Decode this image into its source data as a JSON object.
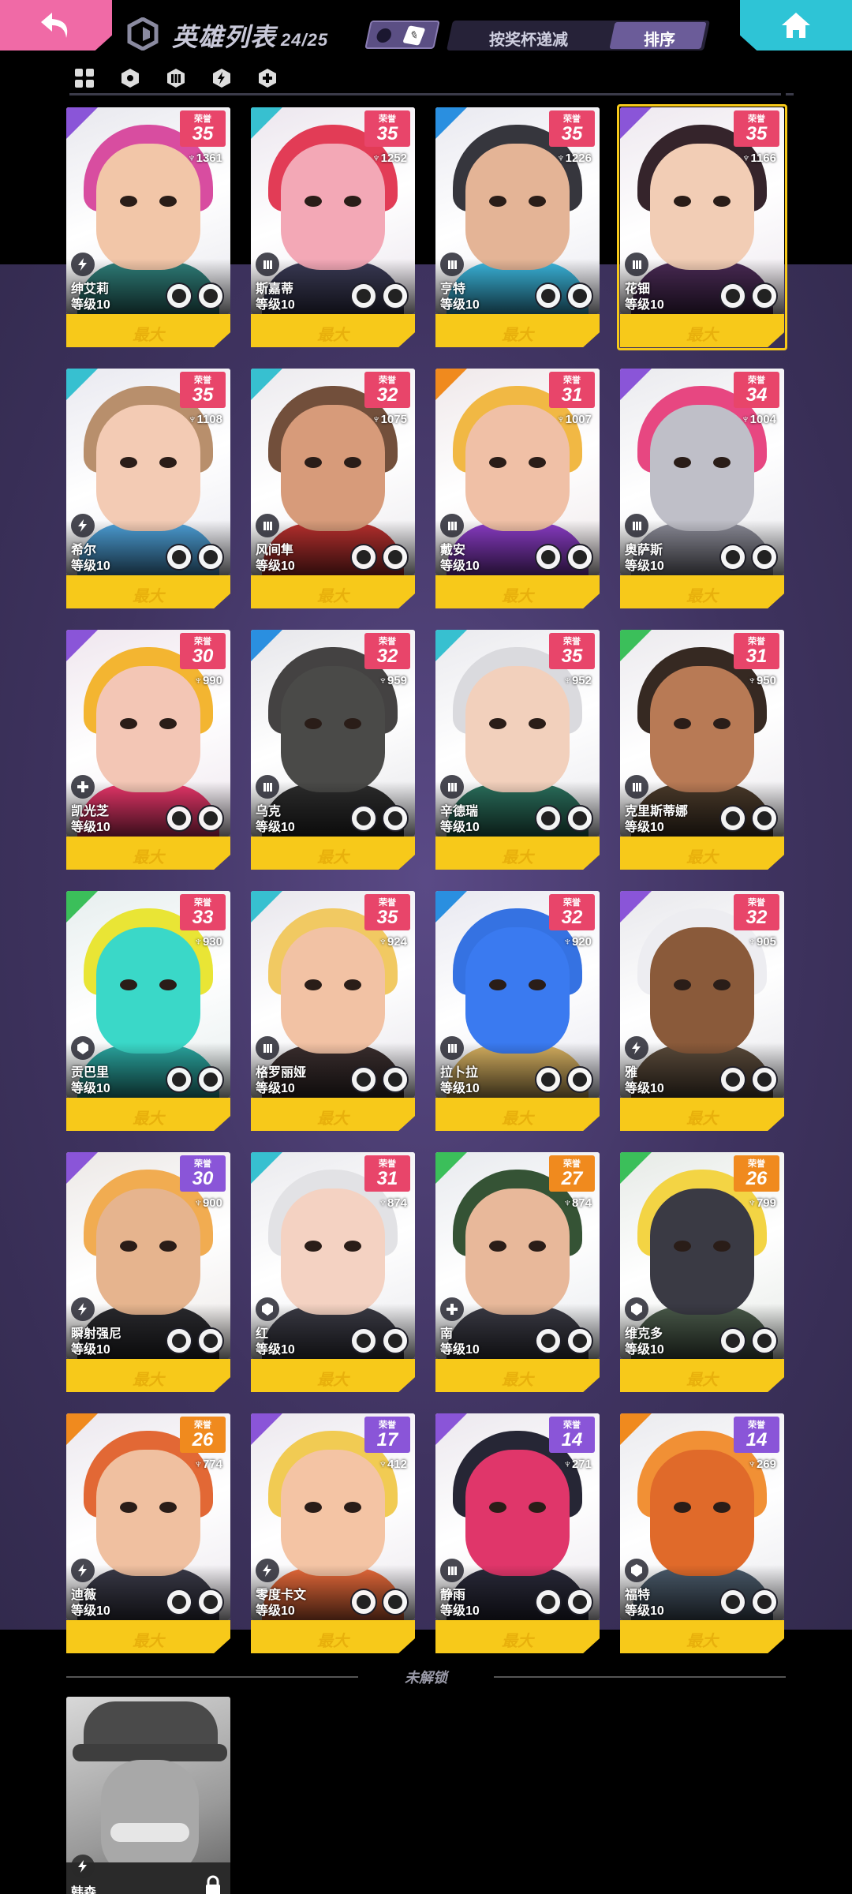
{
  "header": {
    "title": "英雄列表",
    "count": "24/25",
    "filter_label": "按奖杯递减",
    "sort_label": "排序",
    "back_icon": "back-arrow-icon",
    "home_icon": "home-icon",
    "accent_back": "#f06aa6",
    "accent_home": "#2ec4d6"
  },
  "class_tabs": [
    {
      "icon": "grid-all-icon"
    },
    {
      "icon": "shield-icon"
    },
    {
      "icon": "tank-icon"
    },
    {
      "icon": "bolt-icon"
    },
    {
      "icon": "plus-icon"
    }
  ],
  "common": {
    "rank_label": "荣誉",
    "max_label": "最大"
  },
  "heroes": [
    {
      "name": "绅艾莉",
      "level": "等级10",
      "rank": "35",
      "trophies": "1361",
      "rank_color": "#e8456a",
      "tag": "#8a55d8",
      "hair": "#d6439b",
      "skin": "#f2c6a8",
      "body": "#2f7f7a",
      "bg": "#e8e8ee",
      "class": "bolt-icon",
      "selected": false
    },
    {
      "name": "斯嘉蒂",
      "level": "等级10",
      "rank": "35",
      "trophies": "1252",
      "rank_color": "#e8456a",
      "tag": "#37c0d0",
      "hair": "#e0324d",
      "skin": "#f3a8b6",
      "body": "#3a3a55",
      "bg": "#ece6ee",
      "class": "tank-icon",
      "selected": false
    },
    {
      "name": "亨特",
      "level": "等级10",
      "rank": "35",
      "trophies": "1226",
      "rank_color": "#e8456a",
      "tag": "#2a8fe0",
      "hair": "#2b2b33",
      "skin": "#e4b496",
      "body": "#3bb7de",
      "bg": "#e9e9f0",
      "class": "tank-icon",
      "selected": false
    },
    {
      "name": "花钿",
      "level": "等级10",
      "rank": "35",
      "trophies": "1166",
      "rank_color": "#e8456a",
      "tag": "#8a55d8",
      "hair": "#2a1820",
      "skin": "#f2cdb5",
      "body": "#4a2a55",
      "bg": "#eee8ef",
      "class": "tank-icon",
      "selected": true
    },
    {
      "name": "希尔",
      "level": "等级10",
      "rank": "35",
      "trophies": "1108",
      "rank_color": "#e8456a",
      "tag": "#37c0d0",
      "hair": "#b48964",
      "skin": "#f3cbb4",
      "body": "#4da0d8",
      "bg": "#e9e9f0",
      "class": "bolt-icon",
      "selected": false
    },
    {
      "name": "风间隼",
      "level": "等级10",
      "rank": "32",
      "trophies": "1075",
      "rank_color": "#e8456a",
      "tag": "#37c0d0",
      "hair": "#6a4630",
      "skin": "#d79b7a",
      "body": "#b8302e",
      "bg": "#eceaee",
      "class": "tank-icon",
      "selected": false
    },
    {
      "name": "戴安",
      "level": "等级10",
      "rank": "31",
      "trophies": "1007",
      "rank_color": "#e8456a",
      "tag": "#f08a1e",
      "hair": "#f0b43a",
      "skin": "#f0c0a6",
      "body": "#8b3cc7",
      "bg": "#efe8ea",
      "class": "tank-icon",
      "selected": false
    },
    {
      "name": "奥萨斯",
      "level": "等级10",
      "rank": "34",
      "trophies": "1004",
      "rank_color": "#e8456a",
      "tag": "#8a55d8",
      "hair": "#e63d7a",
      "skin": "#bfbfc8",
      "body": "#8a8a96",
      "bg": "#eaeaee",
      "class": "tank-icon",
      "selected": false
    },
    {
      "name": "凯光芝",
      "level": "等级10",
      "rank": "30",
      "trophies": "990",
      "rank_color": "#e8456a",
      "tag": "#8a55d8",
      "hair": "#f2b126",
      "skin": "#f3c6b5",
      "body": "#e8366a",
      "bg": "#efe6ee",
      "class": "plus-icon",
      "selected": false
    },
    {
      "name": "乌克",
      "level": "等级10",
      "rank": "32",
      "trophies": "959",
      "rank_color": "#e8456a",
      "tag": "#2a8fe0",
      "hair": "#3a3838",
      "skin": "#4a4a48",
      "body": "#2c2c2c",
      "bg": "#e6e6ea",
      "class": "tank-icon",
      "selected": false
    },
    {
      "name": "辛德瑞",
      "level": "等级10",
      "rank": "35",
      "trophies": "952",
      "rank_color": "#e8456a",
      "tag": "#37c0d0",
      "hair": "#d8d8dc",
      "skin": "#f2d0bc",
      "body": "#2a6f5c",
      "bg": "#eaeaee",
      "class": "tank-icon",
      "selected": false
    },
    {
      "name": "克里斯蒂娜",
      "level": "等级10",
      "rank": "31",
      "trophies": "950",
      "rank_color": "#e8456a",
      "tag": "#3bbf5a",
      "hair": "#2b1e16",
      "skin": "#b87a55",
      "body": "#4a3a2a",
      "bg": "#eceaee",
      "class": "tank-icon",
      "selected": false
    },
    {
      "name": "贡巴里",
      "level": "等级10",
      "rank": "33",
      "trophies": "930",
      "rank_color": "#e8456a",
      "tag": "#3bbf5a",
      "hair": "#e8e42a",
      "skin": "#3ad8c8",
      "body": "#2aa6a0",
      "bg": "#e6eeee",
      "class": "shield-icon",
      "selected": false
    },
    {
      "name": "格罗丽娅",
      "level": "等级10",
      "rank": "35",
      "trophies": "924",
      "rank_color": "#e8456a",
      "tag": "#37c0d0",
      "hair": "#f0c65a",
      "skin": "#f2c2a4",
      "body": "#3a2e2e",
      "bg": "#e8e6ec",
      "class": "tank-icon",
      "selected": false
    },
    {
      "name": "拉卜拉",
      "level": "等级10",
      "rank": "32",
      "trophies": "920",
      "rank_color": "#e8456a",
      "tag": "#2a8fe0",
      "hair": "#2a6ae0",
      "skin": "#3a7af0",
      "body": "#d6b060",
      "bg": "#e8e8f0",
      "class": "tank-icon",
      "selected": false
    },
    {
      "name": "雅",
      "level": "等级10",
      "rank": "32",
      "trophies": "905",
      "rank_color": "#e8456a",
      "tag": "#8a55d8",
      "hair": "#ececf0",
      "skin": "#8a5a3a",
      "body": "#5a4a3a",
      "bg": "#e8e8ec",
      "class": "bolt-icon",
      "selected": false
    },
    {
      "name": "瞬射强尼",
      "level": "等级10",
      "rank": "30",
      "trophies": "900",
      "rank_color": "#8a55d8",
      "tag": "#8a55d8",
      "hair": "#f0a848",
      "skin": "#e6b48e",
      "body": "#2a2a2e",
      "bg": "#ece8e6",
      "class": "bolt-icon",
      "selected": false
    },
    {
      "name": "红",
      "level": "等级10",
      "rank": "31",
      "trophies": "874",
      "rank_color": "#e8456a",
      "tag": "#37c0d0",
      "hair": "#e0e0e4",
      "skin": "#f4d2c2",
      "body": "#3a3a44",
      "bg": "#eaeaee",
      "class": "shield-icon",
      "selected": false
    },
    {
      "name": "南",
      "level": "等级10",
      "rank": "27",
      "trophies": "874",
      "rank_color": "#f08a1e",
      "tag": "#3bbf5a",
      "hair": "#2a4a2a",
      "skin": "#e8b89a",
      "body": "#3a3a44",
      "bg": "#e8eaee",
      "class": "plus-icon",
      "selected": false
    },
    {
      "name": "维克多",
      "level": "等级10",
      "rank": "26",
      "trophies": "799",
      "rank_color": "#f08a1e",
      "tag": "#3bbf5a",
      "hair": "#f2d23a",
      "skin": "#3a3a44",
      "body": "#4a5a4a",
      "bg": "#e6eae6",
      "class": "shield-icon",
      "selected": false
    },
    {
      "name": "迪薇",
      "level": "等级10",
      "rank": "26",
      "trophies": "774",
      "rank_color": "#f08a1e",
      "tag": "#f08a1e",
      "hair": "#e0602a",
      "skin": "#f0c0a0",
      "body": "#3a3a48",
      "bg": "#ece8ee",
      "class": "bolt-icon",
      "selected": false
    },
    {
      "name": "零度卡文",
      "level": "等级10",
      "rank": "17",
      "trophies": "412",
      "rank_color": "#8a55d8",
      "tag": "#8a55d8",
      "hair": "#f0c84a",
      "skin": "#f4c4a4",
      "body": "#e86a3a",
      "bg": "#ece8ee",
      "class": "bolt-icon",
      "selected": false
    },
    {
      "name": "静雨",
      "level": "等级10",
      "rank": "14",
      "trophies": "271",
      "rank_color": "#8a55d8",
      "tag": "#8a55d8",
      "hair": "#1a1a2a",
      "skin": "#e0366a",
      "body": "#2a2a3a",
      "bg": "#ece8ee",
      "class": "tank-icon",
      "selected": false
    },
    {
      "name": "福特",
      "level": "等级10",
      "rank": "14",
      "trophies": "269",
      "rank_color": "#8a55d8",
      "tag": "#f08a1e",
      "hair": "#f08a2a",
      "skin": "#e06a2a",
      "body": "#4a5a6a",
      "bg": "#eaeaee",
      "class": "shield-icon",
      "selected": false
    }
  ],
  "locked_section": {
    "label": "未解锁",
    "hero": {
      "name": "韩森",
      "class": "bolt-icon",
      "lock_icon": "lock-icon"
    }
  }
}
